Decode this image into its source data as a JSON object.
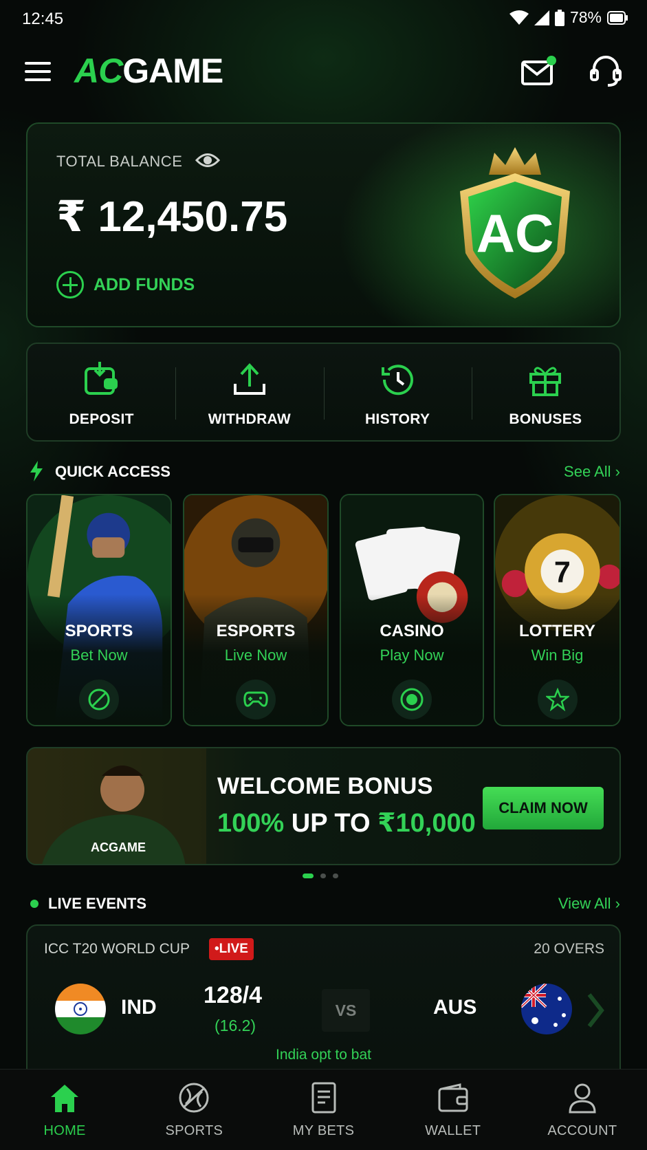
{
  "status_bar": {
    "time": "12:45",
    "battery": "78%"
  },
  "header": {
    "logo_ac": "AC",
    "logo_game": "GAME"
  },
  "balance": {
    "label": "TOTAL BALANCE",
    "value": "₹ 12,450.75",
    "add_funds": "ADD FUNDS",
    "emblem_text": "AC"
  },
  "actions": [
    {
      "label": "DEPOSIT",
      "icon": "wallet-download-icon"
    },
    {
      "label": "WITHDRAW",
      "icon": "upload-icon"
    },
    {
      "label": "HISTORY",
      "icon": "history-icon"
    },
    {
      "label": "BONUSES",
      "icon": "gift-icon"
    }
  ],
  "quick_access": {
    "title": "QUICK ACCESS",
    "see_all": "See All",
    "tiles": [
      {
        "name": "SPORTS",
        "sub": "Bet Now",
        "icon": "sports-ball-icon"
      },
      {
        "name": "ESPORTS",
        "sub": "Live Now",
        "icon": "gamepad-icon"
      },
      {
        "name": "CASINO",
        "sub": "Play Now",
        "icon": "casino-chip-icon"
      },
      {
        "name": "LOTTERY",
        "sub": "Win Big",
        "icon": "star-icon",
        "ball_number": "7"
      }
    ]
  },
  "banner": {
    "title": "WELCOME BONUS",
    "offer_green": "100%",
    "offer_white": "UP TO",
    "offer_amount": "₹10,000",
    "cta": "CLAIM NOW",
    "jersey_text": "ACGAME"
  },
  "live_events": {
    "title": "LIVE EVENTS",
    "view_all": "View All",
    "event": {
      "league": "ICC T20 WORLD CUP",
      "live_badge": "•LIVE",
      "format": "20 OVERS",
      "team_home": "IND",
      "score": "128/4",
      "overs": "(16.2)",
      "vs": "VS",
      "team_away": "AUS",
      "toss": "India opt to bat"
    }
  },
  "bottom_nav": [
    {
      "label": "HOME",
      "active": true
    },
    {
      "label": "SPORTS",
      "active": false
    },
    {
      "label": "MY BETS",
      "active": false
    },
    {
      "label": "WALLET",
      "active": false
    },
    {
      "label": "ACCOUNT",
      "active": false
    }
  ],
  "colors": {
    "accent": "#2bd04e",
    "live": "#d11a1a",
    "background": "#060a08"
  }
}
